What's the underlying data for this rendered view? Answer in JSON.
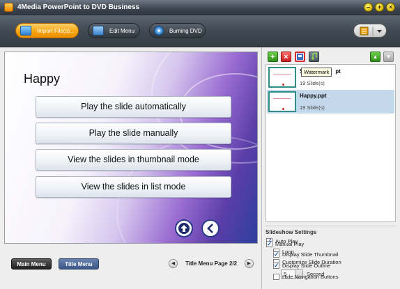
{
  "window": {
    "title": "4Media PowerPoint to DVD Business",
    "buttons": {
      "minimize": "–",
      "maximize": "+",
      "close": "×"
    }
  },
  "toolbar": {
    "import_label": "Import File(s)...",
    "edit_menu_label": "Edit Menu",
    "burning_dvd_label": "Burning DVD",
    "accent_color": "#f7a512"
  },
  "preview": {
    "title": "Happy",
    "menu_items": [
      "Play the slide automatically",
      "Play the slide manually",
      "View the slides in thumbnail mode",
      "View the slides in list mode"
    ]
  },
  "bottom": {
    "main_menu_label": "Main Menu",
    "title_menu_label": "Title Menu",
    "page_label": "Title Menu Page 2/2"
  },
  "files": {
    "items": [
      {
        "name": "S",
        "name_suffix": "pt",
        "count": "19 Slide(s)",
        "selected": false
      },
      {
        "name": "Happy.ppt",
        "count": "19 Slide(s)",
        "selected": true
      }
    ],
    "tooltip": "Watermark"
  },
  "settings": {
    "heading": "Slideshow Settings",
    "auto_play": "Auto Play",
    "loop": "Loop",
    "customize_duration": "Customize Slide Duration",
    "duration_value": "5",
    "duration_unit": "Second",
    "manual_play": "Manual Play",
    "display_thumbnail": "Display Slide Thumbnail",
    "display_outline": "Display Slide Outline",
    "hide_nav": "Hide Navigation Buttons"
  }
}
